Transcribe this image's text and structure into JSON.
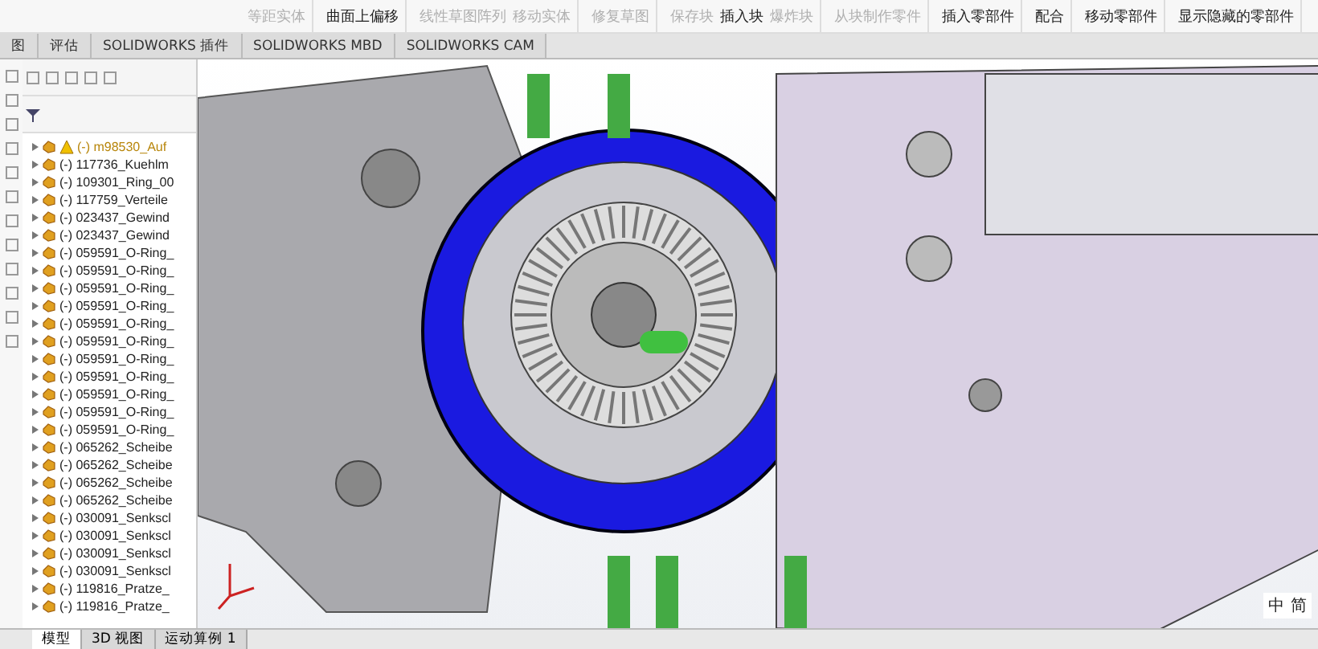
{
  "ribbon": {
    "groups": [
      {
        "items": [
          {
            "label": "等距实体",
            "disabled": true
          }
        ]
      },
      {
        "items": [
          {
            "label": "曲面上偏移",
            "disabled": false
          }
        ]
      },
      {
        "items": [
          {
            "label": "线性草图阵列",
            "disabled": true
          },
          {
            "label": "移动实体",
            "disabled": true
          }
        ]
      },
      {
        "items": [
          {
            "label": "修复草图",
            "disabled": true
          }
        ]
      },
      {
        "items": [
          {
            "label": "保存块",
            "disabled": true
          },
          {
            "label": "插入块",
            "disabled": false
          },
          {
            "label": "爆炸块",
            "disabled": true
          }
        ]
      },
      {
        "items": [
          {
            "label": "从块制作零件",
            "disabled": true
          }
        ]
      },
      {
        "items": [
          {
            "label": "插入零部件",
            "disabled": false
          }
        ]
      },
      {
        "items": [
          {
            "label": "配合",
            "disabled": false
          }
        ]
      },
      {
        "items": [
          {
            "label": "移动零部件",
            "disabled": false
          }
        ]
      },
      {
        "items": [
          {
            "label": "显示隐藏的零部件",
            "disabled": false
          }
        ]
      }
    ]
  },
  "tabs": [
    {
      "label": "图",
      "selected": false
    },
    {
      "label": "评估",
      "selected": false
    },
    {
      "label": "SOLIDWORKS 插件",
      "selected": false
    },
    {
      "label": "SOLIDWORKS MBD",
      "selected": false
    },
    {
      "label": "SOLIDWORKS CAM",
      "selected": false
    }
  ],
  "tree": {
    "rows": [
      {
        "label": "(-) m98530_Auf",
        "warning": true
      },
      {
        "label": "(-) 117736_Kuehlm",
        "warning": false
      },
      {
        "label": "(-) 109301_Ring_00",
        "warning": false
      },
      {
        "label": "(-) 117759_Verteile",
        "warning": false
      },
      {
        "label": "(-) 023437_Gewind",
        "warning": false
      },
      {
        "label": "(-) 023437_Gewind",
        "warning": false
      },
      {
        "label": "(-) 059591_O-Ring_",
        "warning": false
      },
      {
        "label": "(-) 059591_O-Ring_",
        "warning": false
      },
      {
        "label": "(-) 059591_O-Ring_",
        "warning": false
      },
      {
        "label": "(-) 059591_O-Ring_",
        "warning": false
      },
      {
        "label": "(-) 059591_O-Ring_",
        "warning": false
      },
      {
        "label": "(-) 059591_O-Ring_",
        "warning": false
      },
      {
        "label": "(-) 059591_O-Ring_",
        "warning": false
      },
      {
        "label": "(-) 059591_O-Ring_",
        "warning": false
      },
      {
        "label": "(-) 059591_O-Ring_",
        "warning": false
      },
      {
        "label": "(-) 059591_O-Ring_",
        "warning": false
      },
      {
        "label": "(-) 059591_O-Ring_",
        "warning": false
      },
      {
        "label": "(-) 065262_Scheibe",
        "warning": false
      },
      {
        "label": "(-) 065262_Scheibe",
        "warning": false
      },
      {
        "label": "(-) 065262_Scheibe",
        "warning": false
      },
      {
        "label": "(-) 065262_Scheibe",
        "warning": false
      },
      {
        "label": "(-) 030091_Senkscl",
        "warning": false
      },
      {
        "label": "(-) 030091_Senkscl",
        "warning": false
      },
      {
        "label": "(-) 030091_Senkscl",
        "warning": false
      },
      {
        "label": "(-) 030091_Senkscl",
        "warning": false
      },
      {
        "label": "(-) 119816_Pratze_",
        "warning": false
      },
      {
        "label": "(-) 119816_Pratze_",
        "warning": false
      }
    ]
  },
  "bottom_tabs": [
    {
      "label": "模型",
      "selected": true
    },
    {
      "label": "3D 视图",
      "selected": false
    },
    {
      "label": "运动算例 1",
      "selected": false
    }
  ],
  "ime": {
    "items": [
      "中",
      "简"
    ]
  }
}
